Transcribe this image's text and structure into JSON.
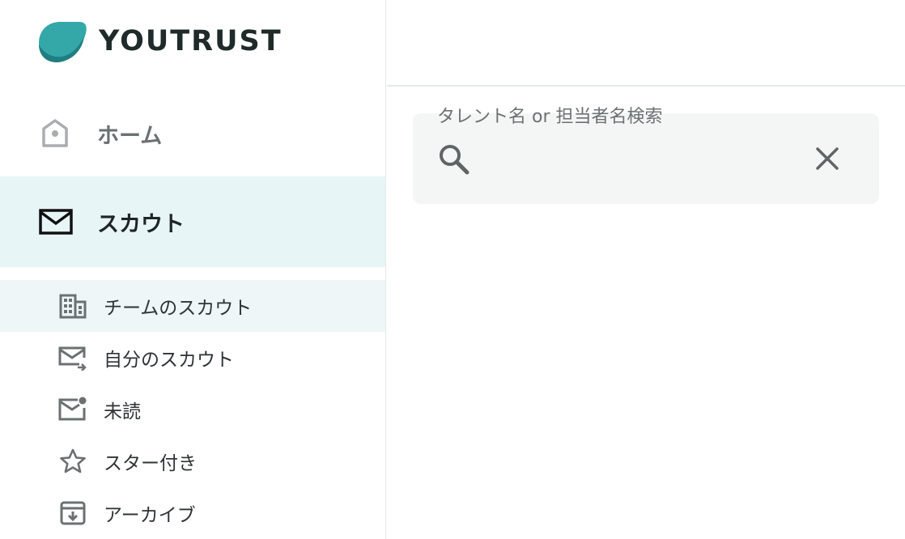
{
  "brand": {
    "name": "YOUTRUST",
    "color": "#2a9ba0"
  },
  "nav": {
    "home": {
      "label": "ホーム",
      "icon": "home-icon"
    },
    "scout": {
      "label": "スカウト",
      "icon": "mail-icon"
    },
    "subitems": [
      {
        "label": "チームのスカウト",
        "icon": "building-icon",
        "active": true
      },
      {
        "label": "自分のスカウト",
        "icon": "mail-send-icon"
      },
      {
        "label": "未読",
        "icon": "mail-unread-icon"
      },
      {
        "label": "スター付き",
        "icon": "star-icon"
      },
      {
        "label": "アーカイブ",
        "icon": "archive-icon"
      }
    ]
  },
  "search": {
    "label": "タレント名 or 担当者名検索",
    "value": "",
    "placeholder": ""
  },
  "colors": {
    "active_bg": "#e7f5f6",
    "sub_active_bg": "#eef6f7",
    "icon": "#6b7173"
  }
}
